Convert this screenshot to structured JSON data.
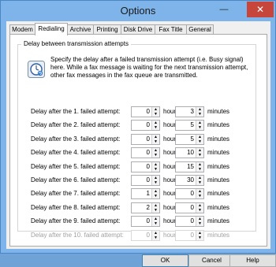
{
  "window": {
    "title": "Options",
    "minimize_icon": "minimize-icon",
    "close_icon": "close-icon"
  },
  "tabs": [
    {
      "label": "Modem",
      "active": false
    },
    {
      "label": "Redialing",
      "active": true
    },
    {
      "label": "Archive",
      "active": false
    },
    {
      "label": "Printing",
      "active": false
    },
    {
      "label": "Disk Drive",
      "active": false
    },
    {
      "label": "Fax Title",
      "active": false
    },
    {
      "label": "General",
      "active": false
    }
  ],
  "group": {
    "title": "Delay between transmission attempts",
    "icon": "clock-refresh-icon",
    "description": "Specify the delay after a failed transmission attempt (i.e. Busy signal) here. While a fax message is waiting for the next transmission attempt, other fax messages in the fax queue are transmitted."
  },
  "units": {
    "hours": "hours",
    "minutes": "minutes"
  },
  "rows": [
    {
      "label": "Delay after the 1. failed attempt:",
      "hours": "0",
      "minutes": "3",
      "enabled": true
    },
    {
      "label": "Delay after the 2. failed attempt:",
      "hours": "0",
      "minutes": "5",
      "enabled": true
    },
    {
      "label": "Delay after the 3. failed attempt:",
      "hours": "0",
      "minutes": "5",
      "enabled": true
    },
    {
      "label": "Delay after the 4. failed attempt:",
      "hours": "0",
      "minutes": "10",
      "enabled": true
    },
    {
      "label": "Delay after the 5. failed attempt:",
      "hours": "0",
      "minutes": "15",
      "enabled": true
    },
    {
      "label": "Delay after the 6. failed attempt:",
      "hours": "0",
      "minutes": "30",
      "enabled": true
    },
    {
      "label": "Delay after the 7. failed attempt:",
      "hours": "1",
      "minutes": "0",
      "enabled": true
    },
    {
      "label": "Delay after the 8. failed attempt:",
      "hours": "2",
      "minutes": "0",
      "enabled": true
    },
    {
      "label": "Delay after the 9. failed attempt:",
      "hours": "0",
      "minutes": "0",
      "enabled": true
    },
    {
      "label": "Delay after the 10. failed attempt:",
      "hours": "0",
      "minutes": "0",
      "enabled": false
    }
  ],
  "buttons": {
    "ok": "OK",
    "cancel": "Cancel",
    "help": "Help"
  }
}
